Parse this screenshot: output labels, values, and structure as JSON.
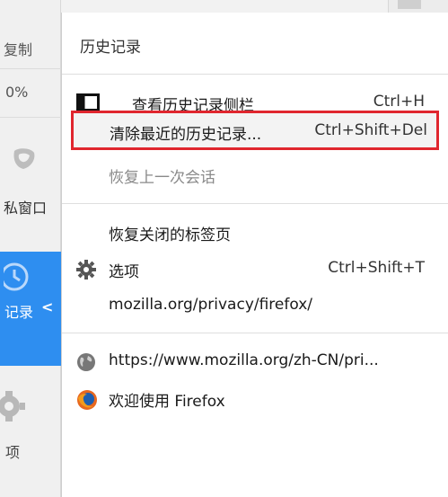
{
  "left_menu": {
    "copy_label": "复制",
    "zoom_label": "0%",
    "private_label": "私窗口",
    "history_label": "记录",
    "options_label": "项"
  },
  "history_panel": {
    "title": "历史记录",
    "items": [
      {
        "label": "查看历史记录侧栏",
        "shortcut": "Ctrl+H",
        "icon": "sidebar-icon"
      },
      {
        "label": "清除最近的历史记录...",
        "shortcut": "Ctrl+Shift+Del",
        "highlighted": true
      },
      {
        "label": "恢复上一次会话",
        "disabled": true
      }
    ],
    "items2": [
      {
        "label": "恢复关闭的标签页"
      },
      {
        "label": "选项",
        "shortcut": "Ctrl+Shift+T",
        "icon": "gear-icon"
      },
      {
        "label": "mozilla.org/privacy/firefox/"
      }
    ],
    "recent": [
      {
        "label": "https://www.mozilla.org/zh-CN/pri...",
        "icon": "globe-icon"
      },
      {
        "label": "欢迎使用 Firefox",
        "icon": "firefox-icon"
      }
    ]
  },
  "colors": {
    "highlight_border": "#e0262e",
    "sidebar_active": "#2e8ef0"
  }
}
